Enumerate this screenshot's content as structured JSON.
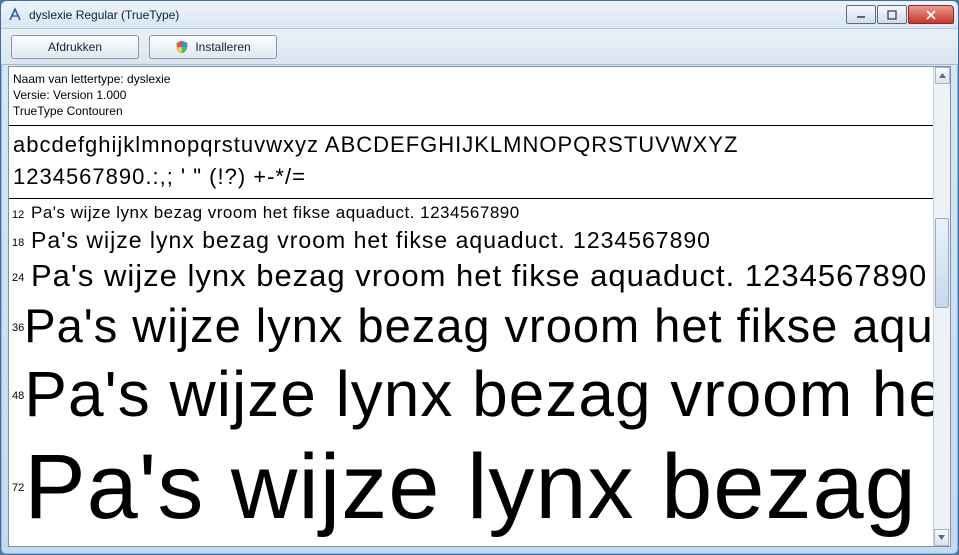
{
  "window": {
    "title": "dyslexie Regular (TrueType)"
  },
  "toolbar": {
    "print_label": "Afdrukken",
    "install_label": "Installeren"
  },
  "meta": {
    "name_line": "Naam van lettertype: dyslexie",
    "version_line": "Versie: Version 1.000",
    "outline_line": "TrueType Contouren"
  },
  "glyphs": {
    "lower_upper": "abcdefghijklmnopqrstuvwxyz  ABCDEFGHIJKLMNOPQRSTUVWXYZ",
    "digits_punct": "1234567890.:,; ' \" (!?) +-*/="
  },
  "pangram": "Pa's wijze lynx bezag vroom het fikse aquaduct. 1234567890",
  "sizes": {
    "s1": "12",
    "s2": "18",
    "s3": "24",
    "s4": "36",
    "s5": "48",
    "s6": "72"
  }
}
